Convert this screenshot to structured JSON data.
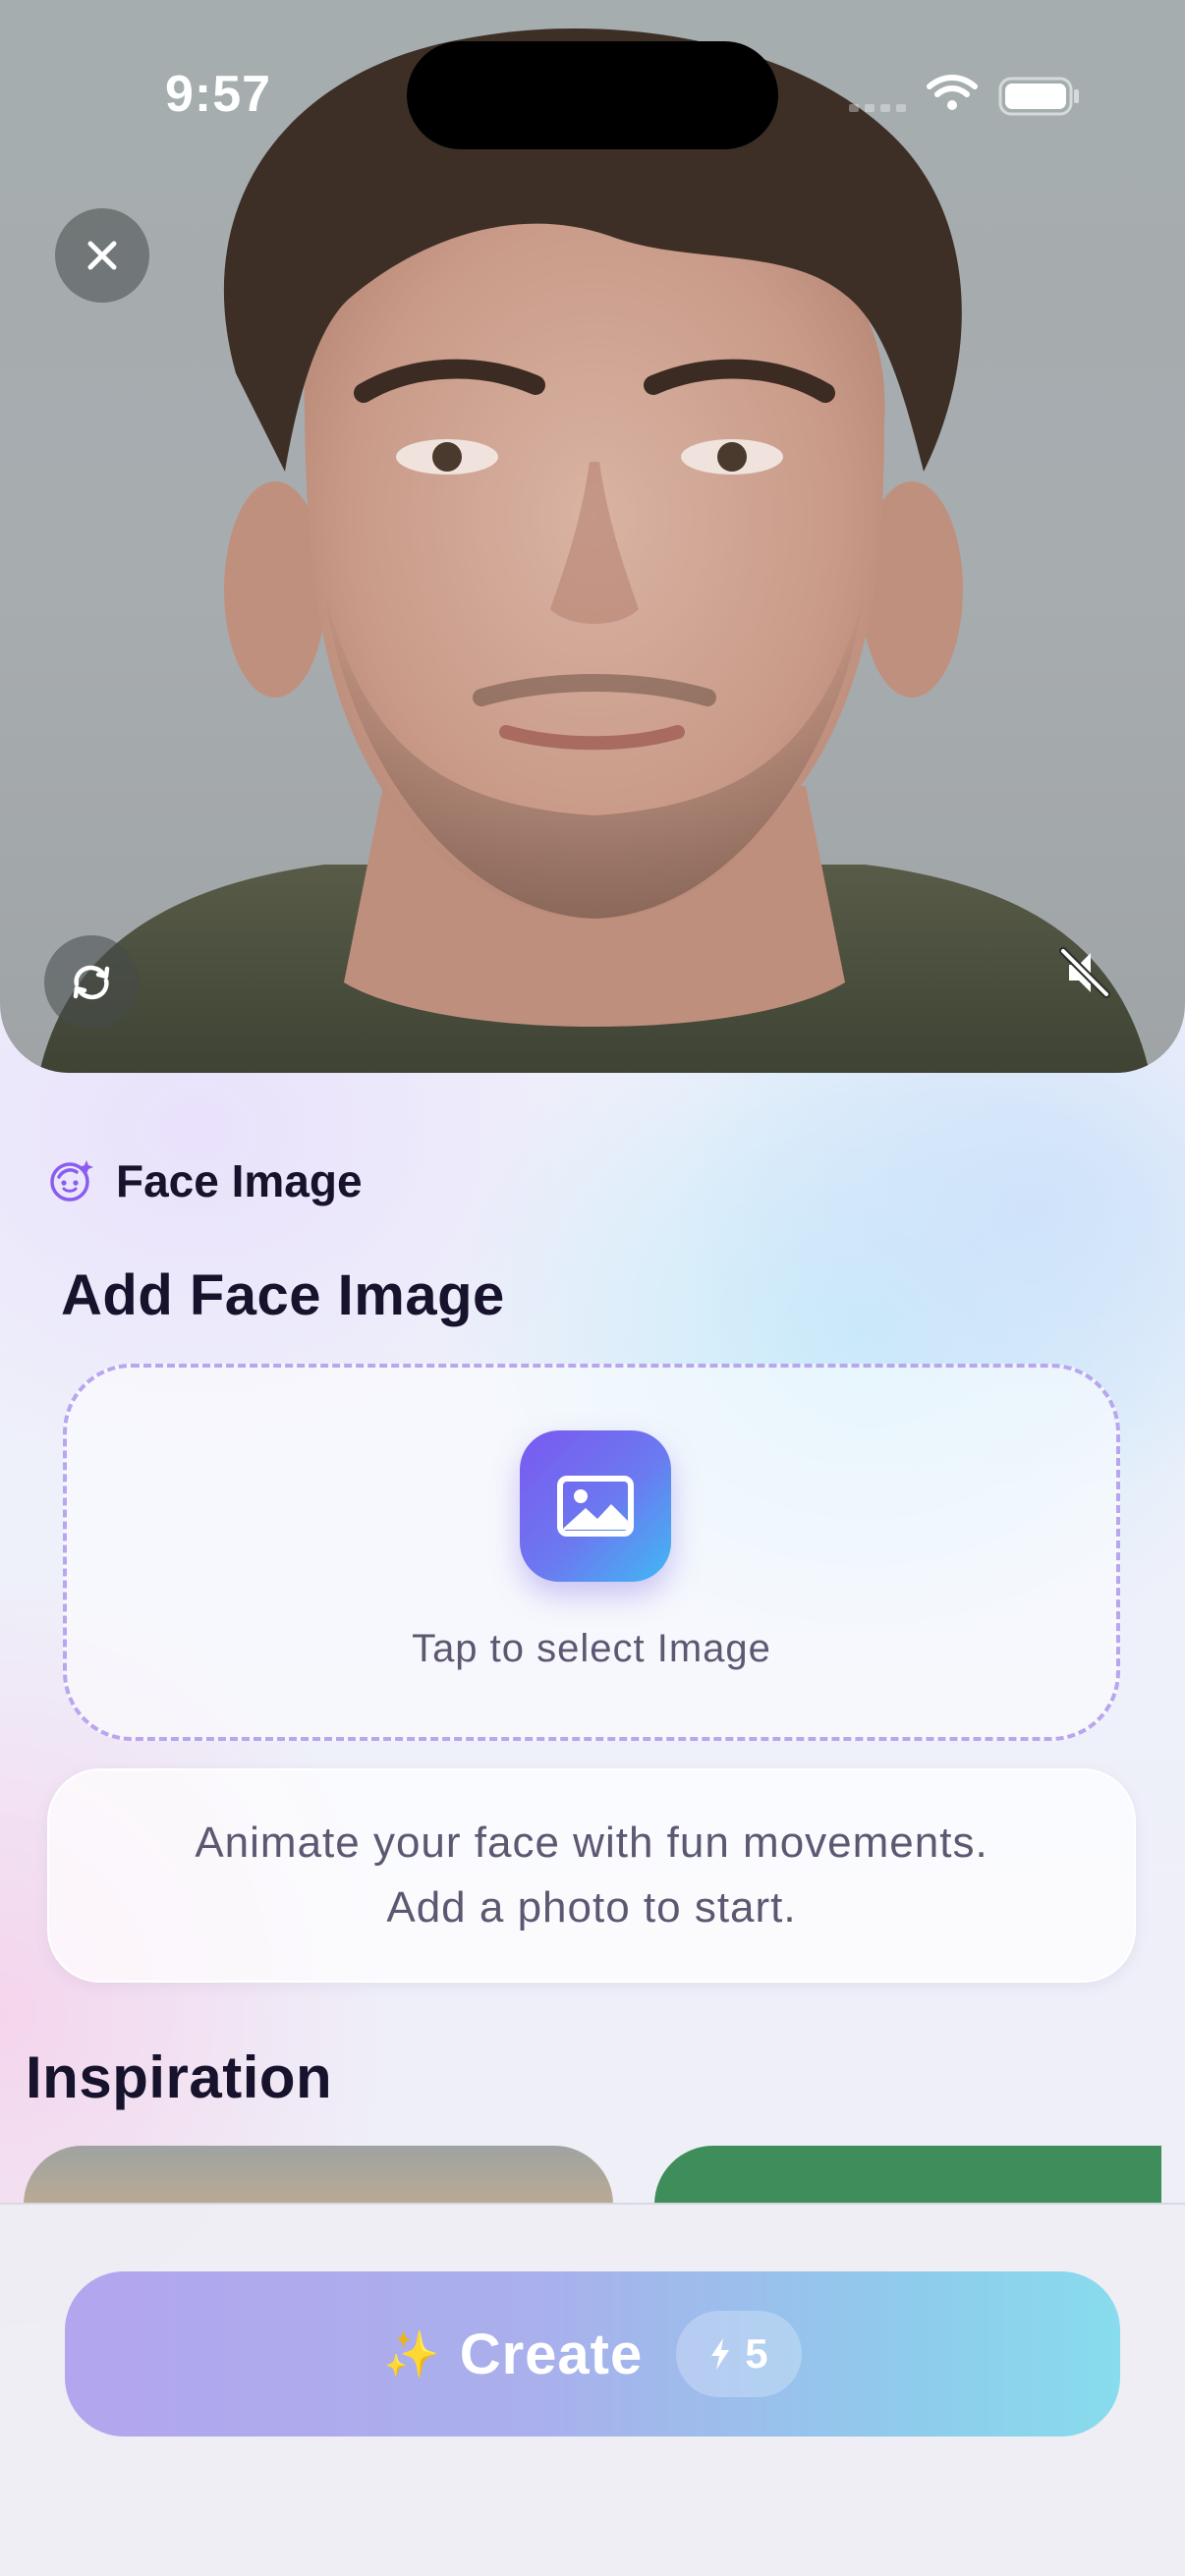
{
  "status_bar": {
    "time": "9:57",
    "icons": [
      "signal-icon",
      "wifi-icon",
      "battery-icon"
    ]
  },
  "video": {
    "controls": [
      "close-icon",
      "refresh-icon",
      "mute-icon"
    ]
  },
  "face_section": {
    "header_icon": "face-sparkle-icon",
    "header_label": "Face Image",
    "title": "Add Face Image",
    "upload_icon": "image-icon",
    "upload_label": "Tap to select Image",
    "info_line1": "Animate your face with fun movements.",
    "info_line2": "Add a photo to start."
  },
  "inspiration": {
    "title": "Inspiration"
  },
  "create": {
    "icon": "sparkles-icon",
    "sparkle_glyph": "✨",
    "label": "Create",
    "cost_icon": "lightning-icon",
    "cost": "5"
  },
  "colors": {
    "accent_purple": "#7a58f0",
    "accent_cyan": "#3fb9f4",
    "title_text": "#17132c",
    "body_text": "#5d5872",
    "dashed_border": "#b8a6ef"
  }
}
